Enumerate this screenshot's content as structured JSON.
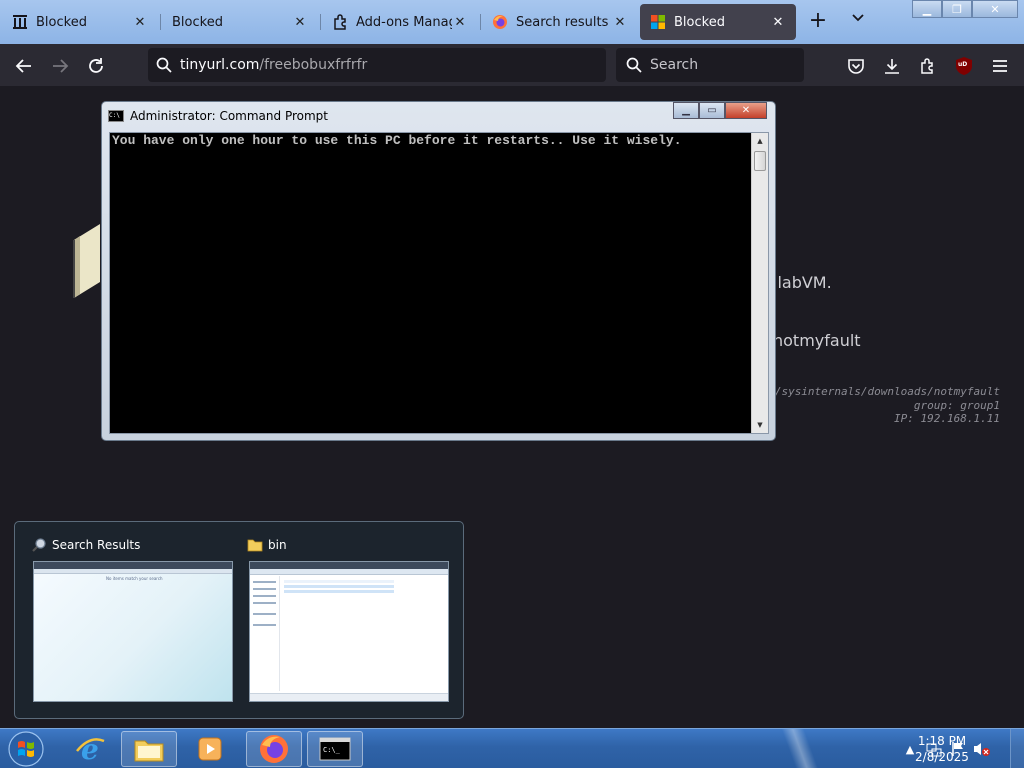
{
  "browser": {
    "tabs": [
      {
        "title": "Blocked",
        "icon": "museum-icon",
        "active": false
      },
      {
        "title": "Blocked",
        "icon": "none",
        "active": false
      },
      {
        "title": "Add-ons Manager",
        "icon": "puzzle-icon",
        "active": false
      },
      {
        "title": "Search results for \"...",
        "icon": "firefox-icon",
        "active": false
      },
      {
        "title": "Blocked",
        "icon": "microsoft-logo-icon",
        "active": true
      }
    ],
    "url_host": "tinyurl.com",
    "url_path": "/freebobuxfrfrfr",
    "search_placeholder": "Search",
    "extension_badge": "uD"
  },
  "page": {
    "text_line1": "llabVM.",
    "text_line2": "notmyfault",
    "mono_line1": "-us/sysinternals/downloads/notmyfault",
    "mono_line2": "group: group1",
    "mono_line3": "IP: 192.168.1.11"
  },
  "cmd": {
    "title": "Administrator:  Command Prompt",
    "output": "You have only one hour to use this PC before it restarts.. Use it wisely."
  },
  "flyout": {
    "items": [
      {
        "title": "Search Results",
        "preview_text": "No items match your search"
      },
      {
        "title": "bin"
      }
    ]
  },
  "taskbar": {
    "time": "1:18 PM",
    "date": "2/8/2025",
    "accent": "#2f63a8"
  }
}
